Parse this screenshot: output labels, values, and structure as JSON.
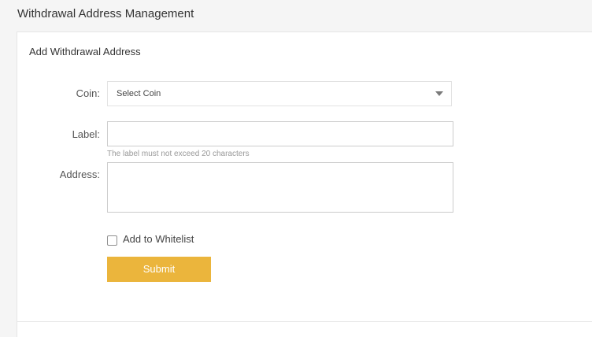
{
  "page": {
    "title": "Withdrawal Address Management"
  },
  "form": {
    "title": "Add Withdrawal Address",
    "coin": {
      "label": "Coin:",
      "selected": "Select Coin"
    },
    "label_field": {
      "label": "Label:",
      "value": "",
      "hint": "The label must not exceed 20 characters"
    },
    "address_field": {
      "label": "Address:",
      "value": ""
    },
    "whitelist": {
      "label": "Add to Whitelist",
      "checked": false
    },
    "submit_label": "Submit"
  },
  "colors": {
    "accent": "#ebb53c",
    "background": "#f5f5f5",
    "card": "#ffffff",
    "hint_text": "#999999"
  },
  "icons": {
    "select_caret": "chevron-down-icon"
  }
}
